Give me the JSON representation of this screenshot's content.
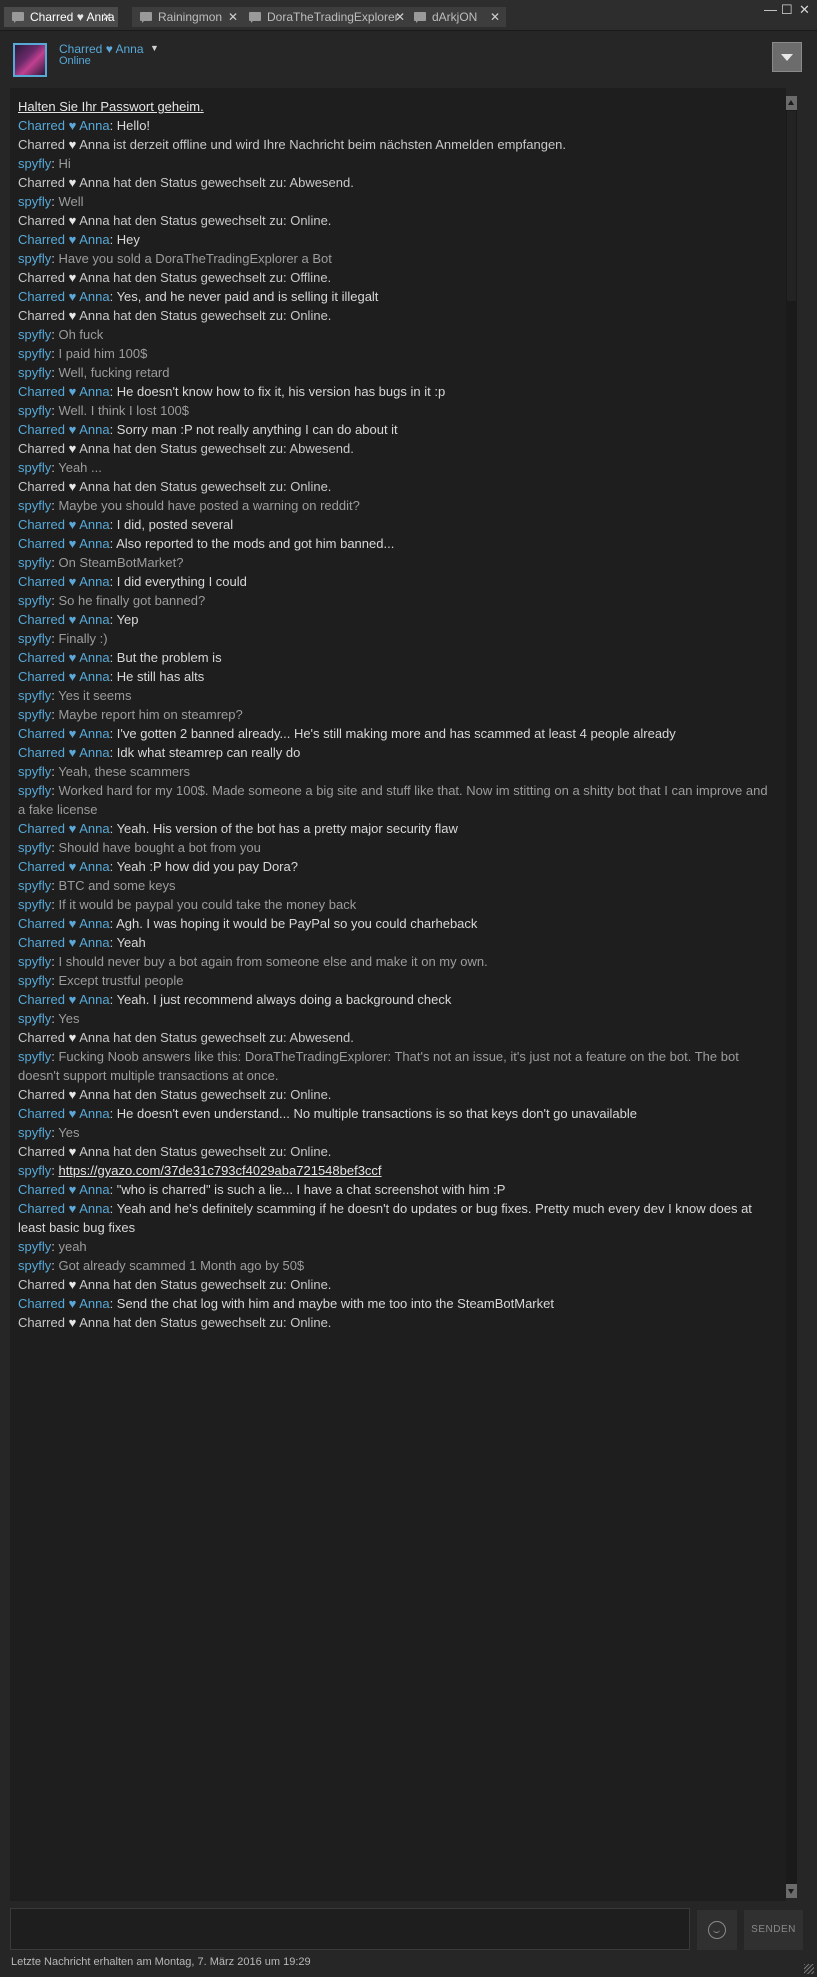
{
  "tabs": [
    {
      "name_a": "Charred",
      "heart": "♥",
      "name_b": "Anna",
      "close": "✕",
      "active": true
    },
    {
      "label": "Rainingmon",
      "close": "✕"
    },
    {
      "label": "DoraTheTradingExplorer",
      "close": "✕"
    },
    {
      "label": "dArkjON",
      "close": "✕"
    }
  ],
  "window": {
    "minimize": "—",
    "maximize": "☐",
    "close": "✕"
  },
  "header": {
    "name_a": "Charred",
    "heart": "♥",
    "name_b": "Anna",
    "status": "Online",
    "caret": "▼"
  },
  "icons": {
    "chat_tab": "chat-bubble-icon",
    "emoji": "smiley-icon",
    "menu": "chevron-down-icon"
  },
  "colors": {
    "name": "#57a9d8",
    "background": "#1e1e1e",
    "self_text": "#d8d8d8",
    "other_text": "#9c9c9c"
  },
  "chat": {
    "warning": "Halten Sie Ihr Passwort geheim.",
    "you": "Charred ♥ Anna",
    "other": "spyfly",
    "messages": [
      {
        "k": "self",
        "t": "Hello!"
      },
      {
        "k": "sys",
        "t": "Charred ♥ Anna ist derzeit offline und wird Ihre Nachricht beim nächsten Anmelden empfangen."
      },
      {
        "k": "other",
        "t": "Hi"
      },
      {
        "k": "sys",
        "t": "Charred ♥ Anna hat den Status gewechselt zu: Abwesend."
      },
      {
        "k": "other",
        "t": "Well"
      },
      {
        "k": "sys",
        "t": "Charred ♥ Anna hat den Status gewechselt zu: Online."
      },
      {
        "k": "self",
        "t": "Hey"
      },
      {
        "k": "other",
        "t": "Have you sold a DoraTheTradingExplorer a Bot"
      },
      {
        "k": "sys",
        "t": "Charred ♥ Anna hat den Status gewechselt zu: Offline."
      },
      {
        "k": "self",
        "t": "Yes, and he never paid and is selling it illegalt"
      },
      {
        "k": "sys",
        "t": "Charred ♥ Anna hat den Status gewechselt zu: Online."
      },
      {
        "k": "other",
        "t": "Oh fuck"
      },
      {
        "k": "other",
        "t": "I paid him 100$"
      },
      {
        "k": "other",
        "t": "Well, fucking retard"
      },
      {
        "k": "self",
        "t": "He doesn't know how to fix it, his version has bugs in it :p"
      },
      {
        "k": "other",
        "t": "Well. I think I lost 100$"
      },
      {
        "k": "self",
        "t": "Sorry man :P not really anything I can do about it"
      },
      {
        "k": "sys",
        "t": "Charred ♥ Anna hat den Status gewechselt zu: Abwesend."
      },
      {
        "k": "other",
        "t": "Yeah ..."
      },
      {
        "k": "sys",
        "t": "Charred ♥ Anna hat den Status gewechselt zu: Online."
      },
      {
        "k": "other",
        "t": "Maybe you should have posted a warning on reddit?"
      },
      {
        "k": "self",
        "t": "I did, posted several"
      },
      {
        "k": "self",
        "t": "Also reported to the mods and got him banned..."
      },
      {
        "k": "other",
        "t": "On SteamBotMarket?"
      },
      {
        "k": "self",
        "t": "I did everything I could"
      },
      {
        "k": "other",
        "t": "So he finally got banned?"
      },
      {
        "k": "self",
        "t": "Yep"
      },
      {
        "k": "other",
        "t": "Finally :)"
      },
      {
        "k": "self",
        "t": "But the problem is"
      },
      {
        "k": "self",
        "t": "He still has alts"
      },
      {
        "k": "other",
        "t": "Yes it seems"
      },
      {
        "k": "other",
        "t": "Maybe report him on steamrep?"
      },
      {
        "k": "self",
        "t": "I've gotten 2 banned already... He's still making more and has scammed at least 4 people already"
      },
      {
        "k": "self",
        "t": "Idk what steamrep can really do"
      },
      {
        "k": "other",
        "t": "Yeah, these scammers"
      },
      {
        "k": "other",
        "t": "Worked hard for my 100$. Made someone a big site and stuff like that. Now im stitting on a shitty bot that I can improve and a fake license"
      },
      {
        "k": "self",
        "t": "Yeah. His version of the bot has a pretty major security flaw"
      },
      {
        "k": "other",
        "t": "Should have bought a bot from you"
      },
      {
        "k": "self",
        "t": "Yeah :P how did you pay Dora?"
      },
      {
        "k": "other",
        "t": "BTC and some keys"
      },
      {
        "k": "other",
        "t": "If it would be paypal you could take the money back"
      },
      {
        "k": "self",
        "t": "Agh. I was hoping it would be PayPal so you could charheback"
      },
      {
        "k": "self",
        "t": "Yeah"
      },
      {
        "k": "other",
        "t": "I should never buy a bot again from someone else and make it on my own."
      },
      {
        "k": "other",
        "t": "Except trustful people"
      },
      {
        "k": "self",
        "t": "Yeah. I just recommend always doing a background check"
      },
      {
        "k": "other",
        "t": "Yes"
      },
      {
        "k": "sys",
        "t": "Charred ♥ Anna hat den Status gewechselt zu: Abwesend."
      },
      {
        "k": "other",
        "t": "Fucking Noob answers like this: DoraTheTradingExplorer: That's not an issue, it's just not a feature on the bot. The bot doesn't support multiple transactions at once."
      },
      {
        "k": "sys",
        "t": "Charred ♥ Anna hat den Status gewechselt zu: Online."
      },
      {
        "k": "self",
        "t": "He doesn't even understand... No multiple transactions is so that keys don't go unavailable"
      },
      {
        "k": "other",
        "t": "Yes"
      },
      {
        "k": "sys",
        "t": "Charred ♥ Anna hat den Status gewechselt zu: Online."
      },
      {
        "k": "other",
        "t": "https://gyazo.com/37de31c793cf4029aba721548bef3ccf",
        "link": true
      },
      {
        "k": "self",
        "t": "\"who is charred\" is such a lie... I have a chat screenshot with him :P"
      },
      {
        "k": "self",
        "t": "Yeah and he's definitely scamming if he doesn't do updates or bug fixes. Pretty much every dev I know does at least basic bug fixes"
      },
      {
        "k": "other",
        "t": "yeah"
      },
      {
        "k": "other",
        "t": "Got already scammed 1 Month ago by 50$"
      },
      {
        "k": "sys",
        "t": "Charred ♥ Anna hat den Status gewechselt zu: Online."
      },
      {
        "k": "self",
        "t": "Send the chat log with him and maybe with me too into the SteamBotMarket"
      },
      {
        "k": "sys",
        "t": "Charred ♥ Anna hat den Status gewechselt zu: Online."
      }
    ]
  },
  "composer": {
    "value": "",
    "send_label": "SENDEN"
  },
  "footer": {
    "text": "Letzte Nachricht erhalten am Montag, 7. März 2016 um 19:29"
  }
}
